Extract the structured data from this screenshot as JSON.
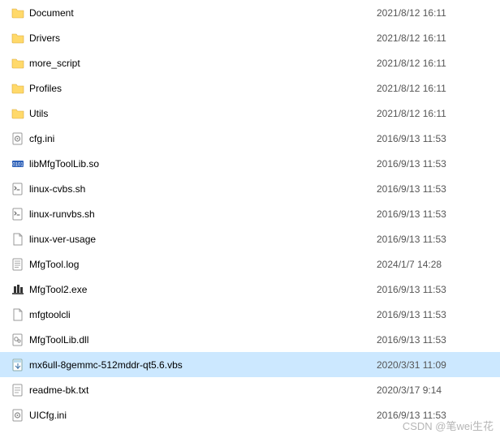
{
  "files": [
    {
      "name": "Document",
      "date": "2021/8/12 16:11",
      "type": "folder",
      "selected": false
    },
    {
      "name": "Drivers",
      "date": "2021/8/12 16:11",
      "type": "folder",
      "selected": false
    },
    {
      "name": "more_script",
      "date": "2021/8/12 16:11",
      "type": "folder",
      "selected": false
    },
    {
      "name": "Profiles",
      "date": "2021/8/12 16:11",
      "type": "folder",
      "selected": false
    },
    {
      "name": "Utils",
      "date": "2021/8/12 16:11",
      "type": "folder",
      "selected": false
    },
    {
      "name": "cfg.ini",
      "date": "2016/9/13 11:53",
      "type": "ini",
      "selected": false
    },
    {
      "name": "libMfgToolLib.so",
      "date": "2016/9/13 11:53",
      "type": "so",
      "selected": false
    },
    {
      "name": "linux-cvbs.sh",
      "date": "2016/9/13 11:53",
      "type": "sh",
      "selected": false
    },
    {
      "name": "linux-runvbs.sh",
      "date": "2016/9/13 11:53",
      "type": "sh",
      "selected": false
    },
    {
      "name": "linux-ver-usage",
      "date": "2016/9/13 11:53",
      "type": "file",
      "selected": false
    },
    {
      "name": "MfgTool.log",
      "date": "2024/1/7 14:28",
      "type": "log",
      "selected": false
    },
    {
      "name": "MfgTool2.exe",
      "date": "2016/9/13 11:53",
      "type": "exe",
      "selected": false
    },
    {
      "name": "mfgtoolcli",
      "date": "2016/9/13 11:53",
      "type": "file",
      "selected": false
    },
    {
      "name": "MfgToolLib.dll",
      "date": "2016/9/13 11:53",
      "type": "dll",
      "selected": false
    },
    {
      "name": "mx6ull-8gemmc-512mddr-qt5.6.vbs",
      "date": "2020/3/31 11:09",
      "type": "vbs",
      "selected": true
    },
    {
      "name": "readme-bk.txt",
      "date": "2020/3/17 9:14",
      "type": "txt",
      "selected": false
    },
    {
      "name": "UICfg.ini",
      "date": "2016/9/13 11:53",
      "type": "ini",
      "selected": false
    }
  ],
  "watermark": "CSDN @笔wei生花"
}
